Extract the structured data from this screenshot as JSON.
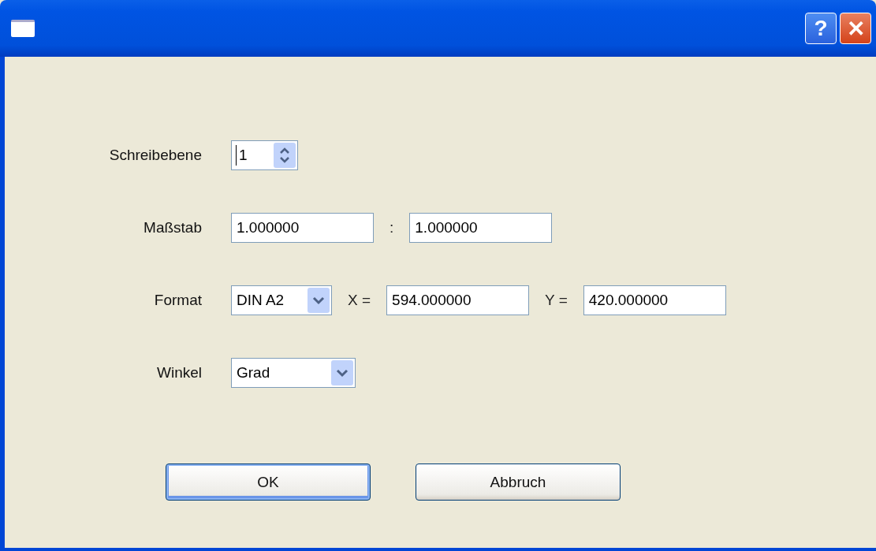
{
  "window": {
    "buttons": [
      {
        "kind": "help",
        "label": "?"
      },
      {
        "kind": "close",
        "label": "✕"
      }
    ]
  },
  "rows": [
    {
      "label": "Schreibebene",
      "controls": [
        {
          "kind": "spinner",
          "value": "1"
        }
      ]
    },
    {
      "label": "Maßstab",
      "controls": [
        {
          "kind": "field",
          "value": "1.000000"
        },
        {
          "kind": "text",
          "text": ":"
        },
        {
          "kind": "field",
          "value": "1.000000"
        }
      ]
    },
    {
      "label": "Format",
      "controls": [
        {
          "kind": "combo",
          "value": "DIN A2"
        },
        {
          "kind": "text",
          "text": "X ="
        },
        {
          "kind": "field",
          "value": "594.000000"
        },
        {
          "kind": "text",
          "text": "Y ="
        },
        {
          "kind": "field",
          "value": "420.000000"
        }
      ]
    },
    {
      "label": "Winkel",
      "controls": [
        {
          "kind": "combo",
          "value": "Grad"
        }
      ]
    }
  ],
  "buttons": [
    {
      "label": "OK",
      "focused": true
    },
    {
      "label": "Abbruch",
      "focused": false
    }
  ]
}
